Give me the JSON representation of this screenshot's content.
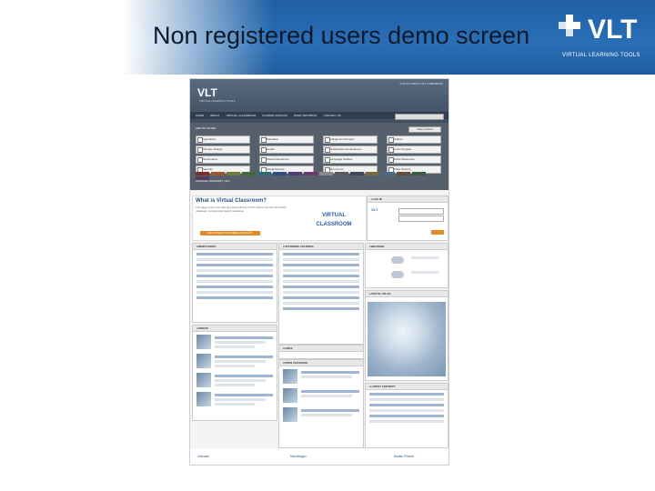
{
  "slide": {
    "title": "Non registered users demo screen",
    "brand_name": "VLT",
    "brand_tagline": "VIRTUAL LEARNING TOOLS",
    "header_color": "#1f5fa4"
  },
  "screenshot": {
    "logo": "VLT",
    "logo_sub": "VIRTUAL LEARNING TOOLS",
    "top_links": "LOG IN  |  ABOUT VLT  |  FEEDBACK",
    "nav": [
      "HOME",
      "ABOUT",
      "VIRTUAL CLASSROOM",
      "COURSE CATALOG",
      "OPEN TEXTBOOK",
      "CONTACT US"
    ],
    "filter_title": "ARCTIC FILTER",
    "filter_button": "Filter content",
    "filter_columns": [
      [
        "Agriculture",
        "Climate Change",
        "Governance",
        "Security"
      ],
      [
        "Education",
        "Health",
        "Natural Resources",
        "Social Science"
      ],
      [
        "Indigenous Peoples",
        "Sustainable Development",
        "Language Studies",
        "Economics"
      ],
      [
        "Culture",
        "Arctic Peoples",
        "Arctic Resources",
        "Polar Science"
      ]
    ],
    "filter_colors": [
      "#7b2f2a",
      "#a0552a",
      "#6f7b3a",
      "#3f6b3a",
      "#2e6b72",
      "#2f5083",
      "#4a3d7a",
      "#6b3a6b",
      "#8a8a8a",
      "#5a5a5a",
      "#3a4a5a",
      "#7a6a3a",
      "#4a6a8a",
      "#6a4a3a",
      "#3a5a4a",
      "#5a3a5a"
    ],
    "filter_footer": "CHANGE CATEGORY  |  ALL",
    "welcome": {
      "title": "What is Virtual Classroom?",
      "text": "The page is the core learning environment of VLT where you can find study materials, courses and useful resources.",
      "logo_text": "VIRTUAL CLASSROOM",
      "button": "REGISTER FOR A FREE ACCOUNT"
    },
    "panels": {
      "login": "LOG IN",
      "weather": "WEATHER",
      "news": "NEWS FEEDS",
      "courses": "UPCOMING COURSES",
      "arctic_atlas": "ARCTIC ATLAS",
      "videos": "VIDEOS",
      "links": "LINKS",
      "open_textbook": "OPEN TEXTBOOK",
      "latest_content": "LATEST CONTENT"
    },
    "footer_partners": [
      "UArctic",
      "Nordregio",
      "Arctic Portal"
    ]
  }
}
